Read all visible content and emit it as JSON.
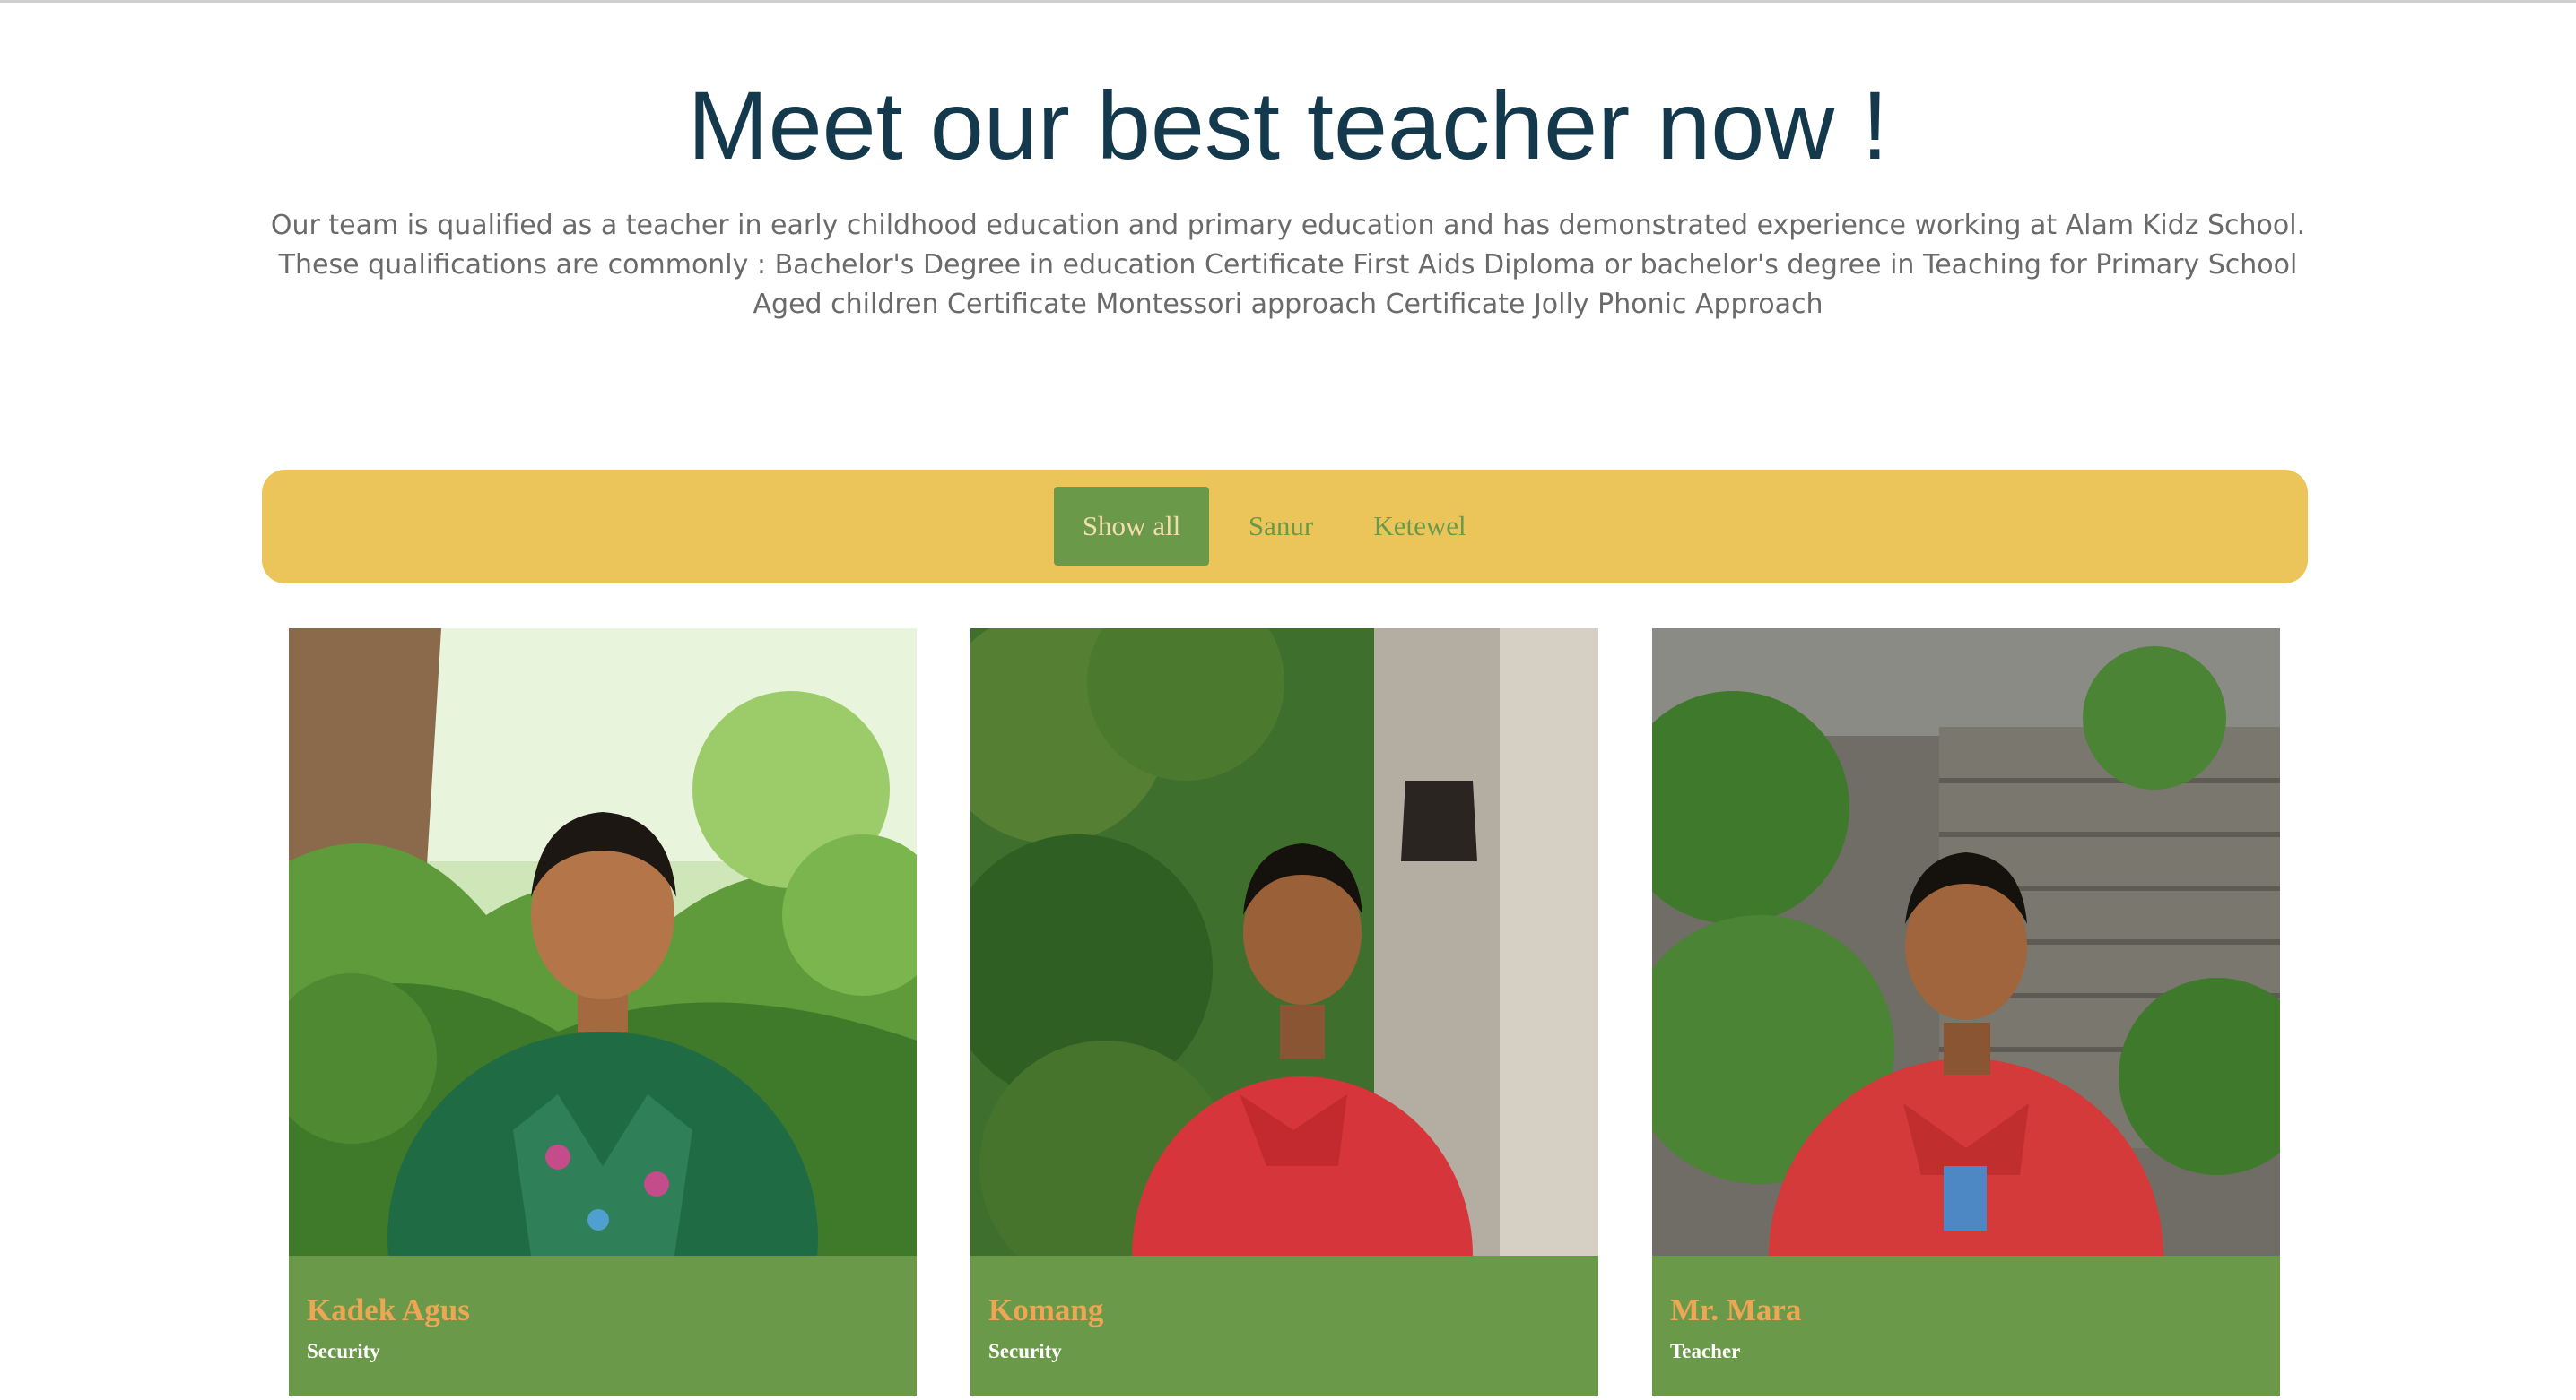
{
  "heading": "Meet our best teacher now !",
  "intro": "Our team is qualified as a teacher in early childhood education and primary education and has demonstrated experience working at Alam Kidz School. These qualifications are commonly : Bachelor's Degree in education Certificate First Aids Diploma or bachelor's degree in Teaching for Primary School Aged children Certificate Montessori approach Certificate Jolly Phonic Approach",
  "filters": [
    {
      "label": "Show all",
      "active": true
    },
    {
      "label": "Sanur",
      "active": false
    },
    {
      "label": "Ketewel",
      "active": false
    }
  ],
  "team": [
    {
      "name": "Kadek Agus",
      "role": "Security"
    },
    {
      "name": "Komang",
      "role": "Security"
    },
    {
      "name": "Mr. Mara",
      "role": "Teacher"
    }
  ],
  "colors": {
    "heading": "#14394d",
    "filter_bar": "#ebc559",
    "accent_green": "#6a9a49",
    "name_orange": "#eea655",
    "body_text": "#6a6a6a"
  }
}
